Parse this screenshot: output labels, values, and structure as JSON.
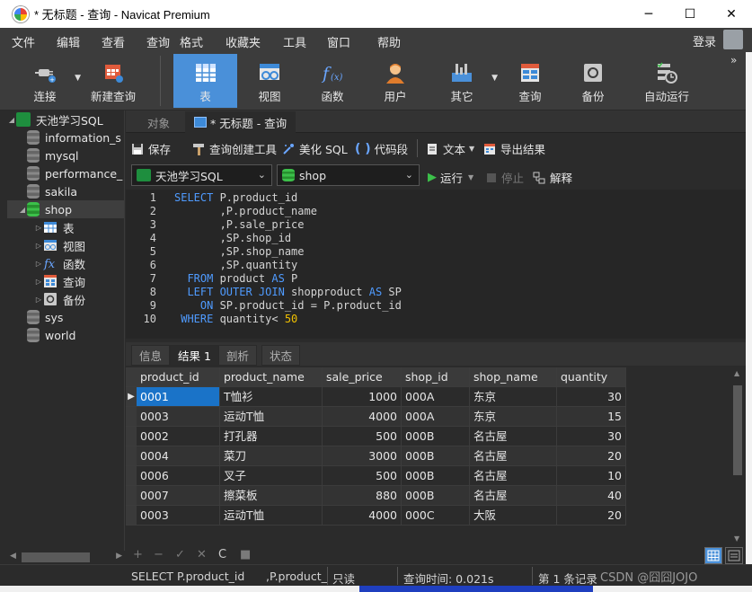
{
  "window": {
    "title": "* 无标题 - 查询 - Navicat Premium",
    "controls": [
      "─",
      "☐",
      "✕"
    ]
  },
  "menu": {
    "items": [
      "文件",
      "编辑",
      "查看",
      "查询",
      "格式",
      "收藏夹",
      "工具",
      "窗口",
      "帮助"
    ],
    "login": "登录"
  },
  "toolbar": {
    "buttons": [
      {
        "label": "连接",
        "icon": "plug-icon"
      },
      {
        "label": "新建查询",
        "icon": "new-query-icon"
      },
      {
        "label": "表",
        "icon": "table-icon",
        "active": true
      },
      {
        "label": "视图",
        "icon": "view-icon"
      },
      {
        "label": "函数",
        "icon": "function-icon"
      },
      {
        "label": "用户",
        "icon": "user-icon"
      },
      {
        "label": "其它",
        "icon": "tools-icon"
      },
      {
        "label": "查询",
        "icon": "query-icon"
      },
      {
        "label": "备份",
        "icon": "backup-icon"
      },
      {
        "label": "自动运行",
        "icon": "schedule-icon"
      }
    ],
    "more": "»"
  },
  "sidebar": {
    "connection": "天池学习SQL",
    "databases": [
      "information_s",
      "mysql",
      "performance_",
      "sakila",
      "shop",
      "sys",
      "world"
    ],
    "selected_db": "shop",
    "shop_children": [
      "表",
      "视图",
      "函数",
      "查询",
      "备份"
    ]
  },
  "tabs": {
    "objects": "对象",
    "query": "* 无标题 - 查询"
  },
  "query_toolbar": {
    "save": "保存",
    "builder": "查询创建工具",
    "beautify": "美化 SQL",
    "snippet": "代码段",
    "text": "文本",
    "export": "导出结果"
  },
  "selectors": {
    "connection": "天池学习SQL",
    "database": "shop",
    "run": "运行",
    "stop": "停止",
    "explain": "解释"
  },
  "editor": {
    "lines": [
      [
        {
          "t": "SELECT ",
          "k": 1
        },
        {
          "t": "P.product_id"
        }
      ],
      [
        {
          "t": "       ,P.product_name"
        }
      ],
      [
        {
          "t": "       ,P.sale_price"
        }
      ],
      [
        {
          "t": "       ,SP.shop_id"
        }
      ],
      [
        {
          "t": "       ,SP.shop_name"
        }
      ],
      [
        {
          "t": "       ,SP.quantity"
        }
      ],
      [
        {
          "t": "  FROM ",
          "k": 1
        },
        {
          "t": "product "
        },
        {
          "t": "AS",
          "k": 1
        },
        {
          "t": " P"
        }
      ],
      [
        {
          "t": "  LEFT OUTER JOIN ",
          "k": 1
        },
        {
          "t": "shopproduct "
        },
        {
          "t": "AS",
          "k": 1
        },
        {
          "t": " SP"
        }
      ],
      [
        {
          "t": "    ON ",
          "k": 1
        },
        {
          "t": "SP.product_id = P.product_id"
        }
      ],
      [
        {
          "t": " WHERE ",
          "k": 1
        },
        {
          "t": "quantity< "
        },
        {
          "t": "50",
          "n": 1
        }
      ]
    ]
  },
  "result_tabs": [
    "信息",
    "结果 1",
    "剖析",
    "状态"
  ],
  "grid": {
    "columns": [
      "product_id",
      "product_name",
      "sale_price",
      "shop_id",
      "shop_name",
      "quantity"
    ],
    "rows": [
      [
        "0001",
        "T恤衫",
        "1000",
        "000A",
        "东京",
        "30"
      ],
      [
        "0003",
        "运动T恤",
        "4000",
        "000A",
        "东京",
        "15"
      ],
      [
        "0002",
        "打孔器",
        "500",
        "000B",
        "名古屋",
        "30"
      ],
      [
        "0004",
        "菜刀",
        "3000",
        "000B",
        "名古屋",
        "20"
      ],
      [
        "0006",
        "叉子",
        "500",
        "000B",
        "名古屋",
        "10"
      ],
      [
        "0007",
        "擦菜板",
        "880",
        "000B",
        "名古屋",
        "40"
      ],
      [
        "0003",
        "运动T恤",
        "4000",
        "000C",
        "大阪",
        "20"
      ]
    ]
  },
  "grid_toolbar": [
    "+",
    "−",
    "✓",
    "✕",
    "C",
    "■"
  ],
  "status": {
    "sql1": "SELECT P.product_id",
    "sql2": ",P.product_",
    "mode": "只读",
    "time": "查询时间: 0.021s",
    "records": "第 1 条记录",
    "watermark": "CSDN @囧囧JOJO"
  }
}
